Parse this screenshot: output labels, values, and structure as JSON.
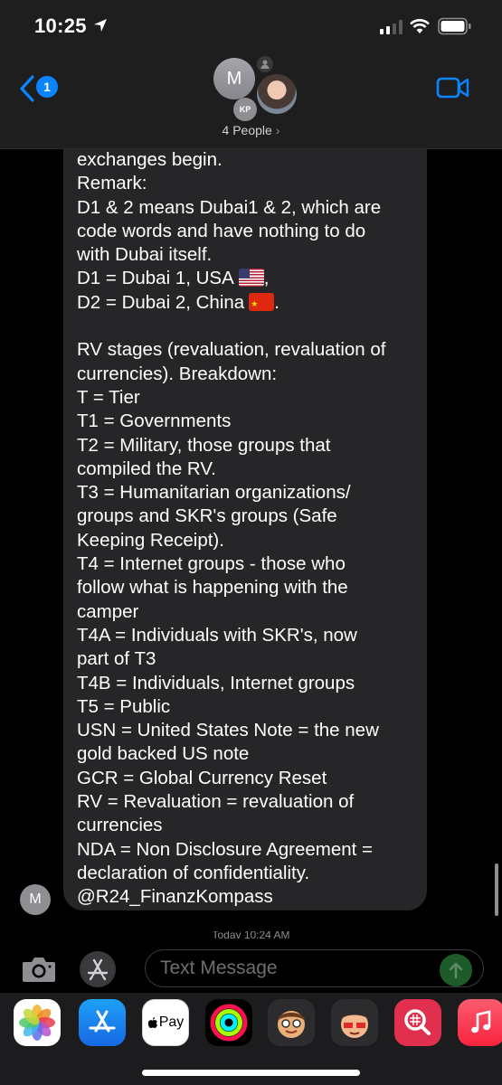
{
  "status_bar": {
    "time": "10:25"
  },
  "header": {
    "back_badge": "1",
    "avatar_initial": "M",
    "avatar_kp": "KP",
    "people_label": "4 People",
    "chevron": "›"
  },
  "message": {
    "lines": [
      "exchanges begin.",
      "Remark:",
      "D1 & 2 means Dubai1 & 2, which are",
      "code words and have nothing to do",
      "with Dubai itself.",
      "D1 = Dubai 1, USA",
      "D2 = Dubai 2, China",
      "",
      "RV stages (revaluation, revaluation of",
      "currencies). Breakdown:",
      "T = Tier",
      "T1 = Governments",
      "T2 = Military, those groups that",
      "compiled the RV.",
      "T3 = Humanitarian organizations/",
      "groups and SKR's groups (Safe",
      "Keeping Receipt).",
      "T4 = Internet groups - those who",
      "follow what is happening with the",
      "camper",
      "T4A = Individuals with SKR's, now",
      "part of T3",
      "T4B = Individuals, Internet groups",
      "T5 = Public",
      "USN = United States Note = the new",
      "gold backed US note",
      "GCR = Global Currency Reset",
      "RV = Revaluation = revaluation of",
      "currencies",
      "NDA = Non Disclosure Agreement =",
      "declaration of confidentiality.",
      "@R24_FinanzKompass"
    ],
    "line5_suffix": ",",
    "line6_suffix": ".",
    "sender_initial": "M"
  },
  "timestamp": "Today 10:24 AM",
  "composer": {
    "placeholder": "Text Message"
  },
  "app_drawer": {
    "apps": [
      "photos-app",
      "app-store-app",
      "apple-pay-app",
      "activity-app",
      "memoji-app",
      "animoji-app",
      "search-images-app",
      "music-app"
    ],
    "apple_pay_label": "Pay"
  },
  "colors": {
    "bubble": "#262628",
    "accent_blue": "#0a84ff",
    "send_green": "#1e5b2a",
    "background": "#000000"
  }
}
